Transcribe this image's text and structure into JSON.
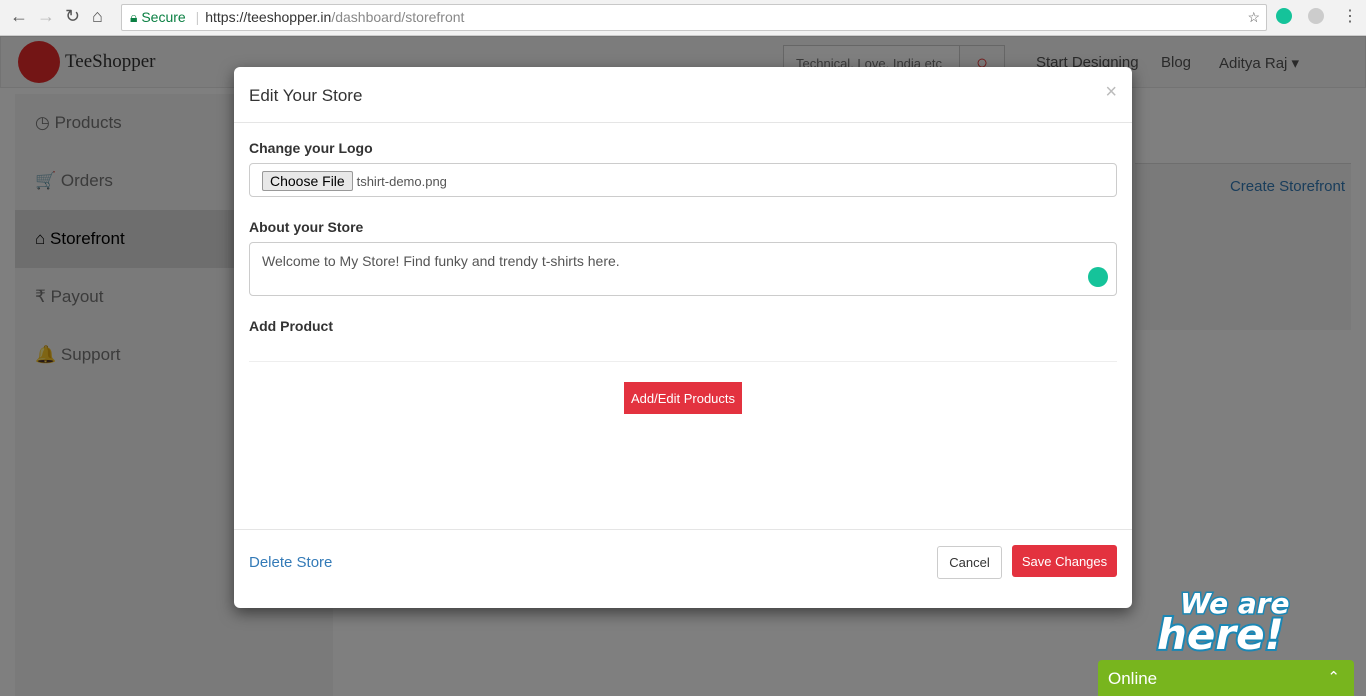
{
  "browser": {
    "secure_label": "Secure",
    "url_host": "https://teeshopper.in",
    "url_path": "/dashboard/storefront"
  },
  "site": {
    "brand": "TeeShopper",
    "search_placeholder": "Technical, Love, India etc",
    "nav": [
      "Start Designing",
      "Blog",
      "Aditya Raj ▾"
    ]
  },
  "sidebar": {
    "items": [
      {
        "icon": "dashboard-icon",
        "glyph": "◷",
        "label": "Products"
      },
      {
        "icon": "cart-icon",
        "glyph": "🛒",
        "label": "Orders"
      },
      {
        "icon": "home-icon",
        "glyph": "⌂",
        "label": "Storefront"
      },
      {
        "icon": "rupee-icon",
        "glyph": "₹",
        "label": "Payout"
      },
      {
        "icon": "bell-icon",
        "glyph": "🔔",
        "label": "Support"
      }
    ]
  },
  "main": {
    "create_link": "Create Storefront"
  },
  "modal": {
    "title": "Edit Your Store",
    "close": "×",
    "logo_label": "Change your Logo",
    "choose_file": "Choose File",
    "file_name": "tshirt-demo.png",
    "about_label": "About your Store",
    "about_value": "Welcome to My Store! Find funky and trendy t-shirts here.",
    "add_product_label": "Add Product",
    "add_edit_button": "Add/Edit Products",
    "delete_link": "Delete Store",
    "cancel": "Cancel",
    "save": "Save Changes"
  },
  "chat": {
    "banner": "We are here!",
    "status": "Online"
  },
  "colors": {
    "accent": "#e3323f",
    "link": "#337ab7",
    "chat": "#78b51e"
  }
}
